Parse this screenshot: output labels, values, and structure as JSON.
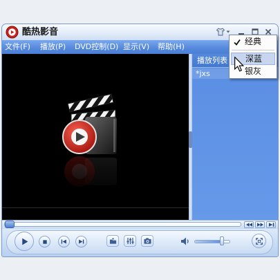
{
  "window": {
    "title": "酷热影音",
    "icons": {
      "logo": "app-logo-icon",
      "skin": "skin-icon",
      "minimize": "minimize-icon",
      "maximize": "maximize-icon",
      "close": "close-icon"
    }
  },
  "menu": {
    "items": [
      "文件(F)",
      "播放(P)",
      "DVD控制(D)",
      "显示(V)",
      "帮助(H)"
    ]
  },
  "skin_menu": {
    "items": [
      {
        "label": "经典",
        "checked": true,
        "highlighted": false
      },
      {
        "label": "深蓝",
        "checked": false,
        "highlighted": true
      },
      {
        "label": "银灰",
        "checked": false,
        "highlighted": false
      }
    ]
  },
  "playlist": {
    "header": "播放列表",
    "items": [
      {
        "name": "*jxs"
      }
    ]
  },
  "playback": {
    "progress_percent": 0,
    "volume_percent": 78
  },
  "seek_buttons": {
    "icons": [
      "slow-icon",
      "fast-icon",
      "frame-step-icon"
    ]
  },
  "controls": {
    "icons": [
      "play-icon",
      "stop-icon",
      "previous-icon",
      "next-icon",
      "open-file-icon",
      "equalizer-icon",
      "snapshot-icon",
      "volume-icon",
      "fullscreen-icon"
    ]
  },
  "colors": {
    "menu_bar": "#5588dc",
    "playlist_bg": "#5a8ee3",
    "video_bg": "#000000",
    "logo_red": "#c8201a",
    "menu_highlight": "#c7d6ee"
  }
}
